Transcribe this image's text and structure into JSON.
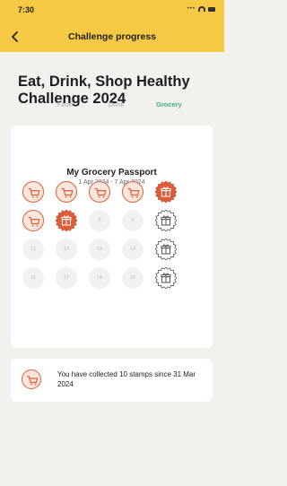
{
  "status": {
    "time": "7:30"
  },
  "nav": {
    "title": "Challenge progress",
    "back_icon": "chevron-left-icon"
  },
  "heading": "Eat, Drink, Shop Healthy Challenge 2024",
  "tabs": [
    {
      "label": "Food",
      "active": false
    },
    {
      "label": "Drink",
      "active": false
    },
    {
      "label": "Grocery",
      "active": true
    }
  ],
  "passport": {
    "title": "My Grocery Passport",
    "dates": "1 Apr 2024 - 7 Apr 2024",
    "stamps": [
      {
        "type": "cart"
      },
      {
        "type": "cart"
      },
      {
        "type": "cart"
      },
      {
        "type": "cart"
      },
      {
        "type": "gift-filled"
      },
      {
        "type": "cart"
      },
      {
        "type": "gift-filled"
      },
      {
        "type": "number",
        "label": "8"
      },
      {
        "type": "number",
        "label": "9"
      },
      {
        "type": "gift-outline"
      },
      {
        "type": "number",
        "label": "11"
      },
      {
        "type": "number",
        "label": "12"
      },
      {
        "type": "number",
        "label": "13"
      },
      {
        "type": "number",
        "label": "14"
      },
      {
        "type": "gift-outline"
      },
      {
        "type": "number",
        "label": "16"
      },
      {
        "type": "number",
        "label": "17"
      },
      {
        "type": "number",
        "label": "18"
      },
      {
        "type": "number",
        "label": "19"
      },
      {
        "type": "gift-outline"
      }
    ]
  },
  "summary": {
    "text": "You have collected 10 stamps since 31 Mar 2024",
    "icon": "cart-icon"
  },
  "colors": {
    "header": "#f6c944",
    "accent": "#e05d3a",
    "active_tab": "#3fae82"
  }
}
